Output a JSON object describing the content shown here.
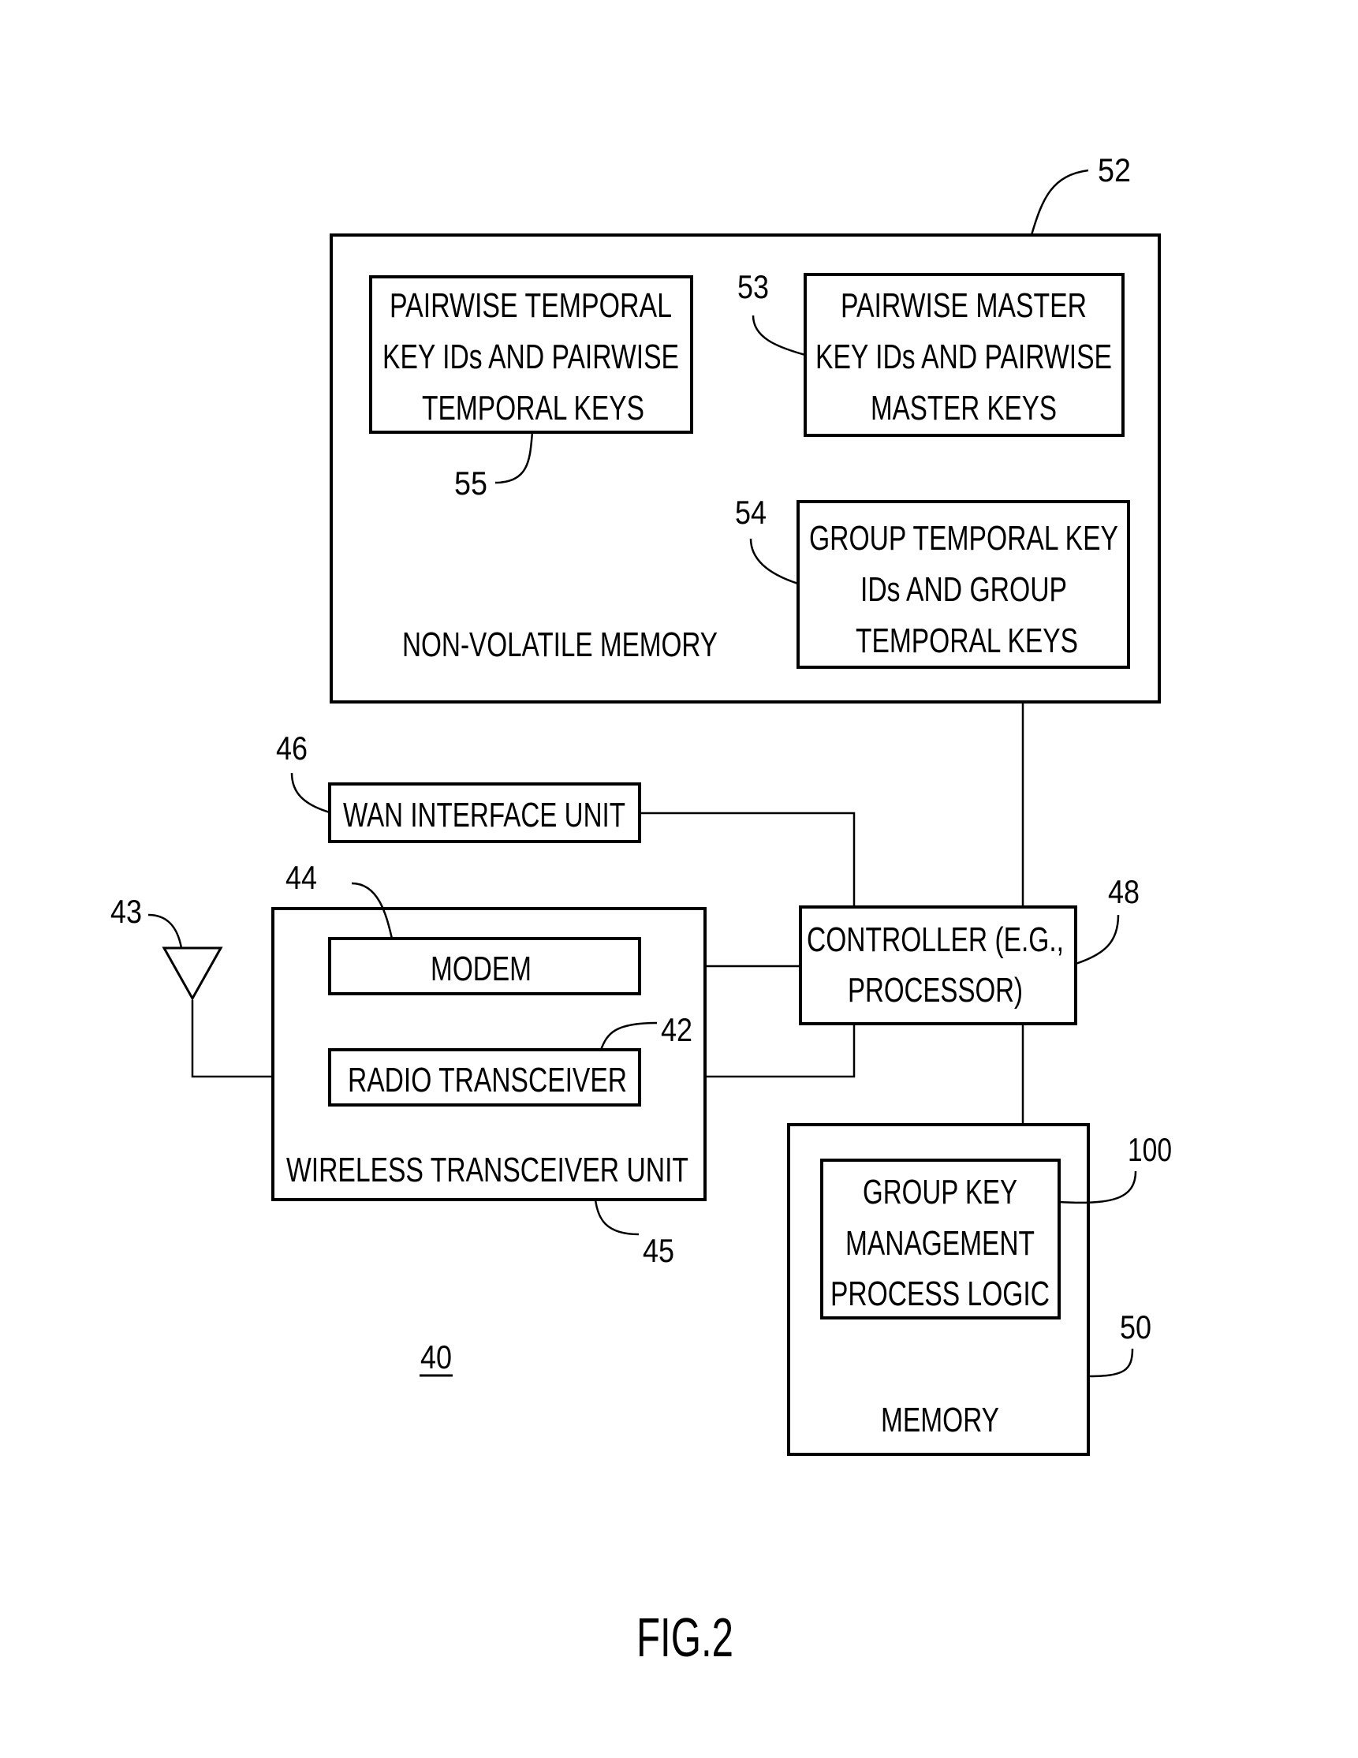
{
  "figure": {
    "caption": "FIG.2",
    "device_ref": "40"
  },
  "blocks": {
    "non_volatile_memory": {
      "ref": "52",
      "label": [
        "NON-VOLATILE MEMORY"
      ]
    },
    "pairwise_temporal_keys": {
      "ref": "55",
      "label": [
        "PAIRWISE TEMPORAL",
        "KEY IDs AND PAIRWISE",
        "TEMPORAL KEYS"
      ]
    },
    "pairwise_master_keys": {
      "ref": "53",
      "label": [
        "PAIRWISE MASTER",
        "KEY IDs AND PAIRWISE",
        "MASTER KEYS"
      ]
    },
    "group_temporal_keys": {
      "ref": "54",
      "label": [
        "GROUP TEMPORAL KEY",
        "IDs AND GROUP",
        "TEMPORAL KEYS"
      ]
    },
    "wan_interface_unit": {
      "ref": "46",
      "label": [
        "WAN INTERFACE UNIT"
      ]
    },
    "wireless_transceiver_unit": {
      "ref": "45",
      "label": [
        "WIRELESS TRANSCEIVER UNIT"
      ]
    },
    "modem": {
      "ref": "44",
      "label": [
        "MODEM"
      ]
    },
    "radio_transceiver": {
      "ref": "42",
      "label": [
        "RADIO TRANSCEIVER"
      ]
    },
    "antenna": {
      "ref": "43"
    },
    "controller": {
      "ref": "48",
      "label": [
        "CONTROLLER (E.G.,",
        "PROCESSOR)"
      ]
    },
    "memory": {
      "ref": "50",
      "label": [
        "MEMORY"
      ]
    },
    "group_key_management": {
      "ref": "100",
      "label": [
        "GROUP KEY",
        "MANAGEMENT",
        "PROCESS LOGIC"
      ]
    }
  }
}
